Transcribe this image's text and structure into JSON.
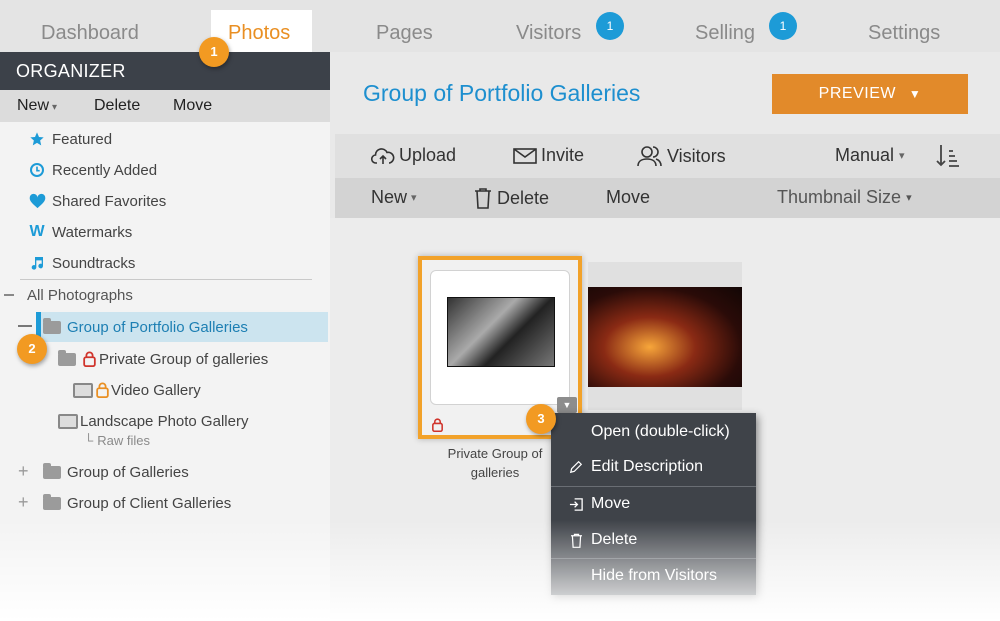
{
  "nav": {
    "tabs": [
      {
        "label": "Dashboard"
      },
      {
        "label": "Photos"
      },
      {
        "label": "Pages"
      },
      {
        "label": "Visitors",
        "badge": "1"
      },
      {
        "label": "Selling",
        "badge": "1"
      },
      {
        "label": "Settings"
      }
    ]
  },
  "organizer": {
    "title": "ORGANIZER",
    "toolbar": {
      "new": "New",
      "delete": "Delete",
      "move": "Move"
    },
    "quick": [
      {
        "label": "Featured",
        "icon": "star-icon"
      },
      {
        "label": "Recently Added",
        "icon": "clock-icon"
      },
      {
        "label": "Shared Favorites",
        "icon": "heart-icon"
      },
      {
        "label": "Watermarks",
        "icon": "watermark-icon"
      },
      {
        "label": "Soundtracks",
        "icon": "music-note-icon"
      }
    ],
    "tree": {
      "root": "All Photographs",
      "portfolio": "Group of Portfolio Galleries",
      "private_group": "Private Group of galleries",
      "video": "Video Gallery",
      "landscape": "Landscape Photo Gallery",
      "raw": "Raw files",
      "galleries": "Group of Galleries",
      "client": "Group of Client Galleries"
    }
  },
  "main": {
    "title": "Group of Portfolio Galleries",
    "preview_label": "PREVIEW",
    "bar1": {
      "upload": "Upload",
      "invite": "Invite",
      "visitors": "Visitors",
      "sort": "Manual"
    },
    "bar2": {
      "new": "New",
      "delete": "Delete",
      "move": "Move",
      "thumb_size": "Thumbnail Size"
    },
    "card_label": "Private Group of galleries"
  },
  "context_menu": {
    "open": "Open (double-click)",
    "edit": "Edit Description",
    "move": "Move",
    "delete": "Delete",
    "hide": "Hide from Visitors"
  },
  "steps": [
    "1",
    "2",
    "3"
  ],
  "colors": {
    "accent": "#e98f23",
    "brand_blue": "#1d9bd7",
    "dark": "#3c4149"
  }
}
